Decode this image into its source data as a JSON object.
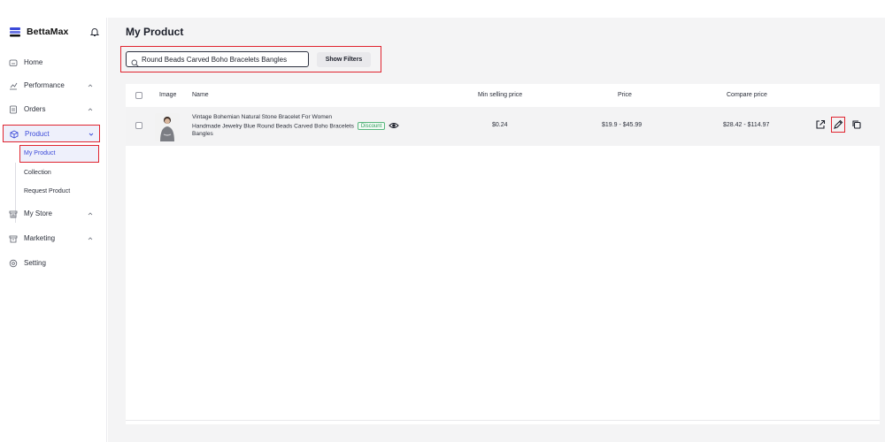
{
  "brand": {
    "name": "BettaMax"
  },
  "sidebar": {
    "items": [
      {
        "label": "Home",
        "icon": "home-icon"
      },
      {
        "label": "Performance",
        "icon": "performance-icon"
      },
      {
        "label": "Orders",
        "icon": "orders-icon"
      },
      {
        "label": "Product",
        "icon": "product-icon"
      },
      {
        "label": "My Store",
        "icon": "store-icon"
      },
      {
        "label": "Marketing",
        "icon": "marketing-icon"
      },
      {
        "label": "Setting",
        "icon": "setting-icon"
      }
    ],
    "product_sub": [
      "My Product",
      "Collection",
      "Request Product"
    ]
  },
  "page": {
    "title": "My Product"
  },
  "search": {
    "value": "Round Beads Carved Boho Bracelets Bangles",
    "filter_label": "Show Filters"
  },
  "table": {
    "headers": [
      "Image",
      "Name",
      "Min selling price",
      "Price",
      "Compare price"
    ],
    "rows": [
      {
        "name_line1": "Vintage Bohemian Natural Stone Bracelet For Women",
        "name_line2": "Handmade Jewelry Blue Round Beads Carved Boho Bracelets",
        "name_line3": "Bangles",
        "badge": "Discount",
        "min_price": "$0.24",
        "price": "$19.9 - $45.99",
        "compare_price": "$28.42 - $114.97"
      }
    ]
  },
  "colors": {
    "accent": "#3b4ad9",
    "highlight": "#e0242f",
    "badge": "#2f9e5d"
  }
}
